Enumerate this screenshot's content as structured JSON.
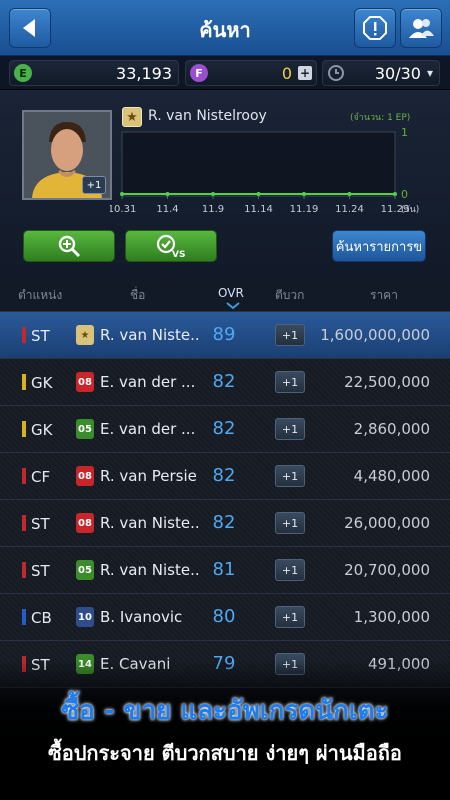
{
  "header": {
    "title": "ค้นหา"
  },
  "currency": {
    "e_label": "E",
    "e_value": "33,193",
    "f_label": "F",
    "f_value": "0",
    "plus": "+",
    "energy_value": "30/30",
    "dropdown": "▾"
  },
  "player": {
    "name": "R. van Nistelrooy",
    "photo_badge": "+1",
    "ep_note": "(จำนวน: 1 EP)",
    "chart_data": {
      "type": "line",
      "x": [
        "10.31",
        "11.4",
        "11.9",
        "11.14",
        "11.19",
        "11.24",
        "11.29"
      ],
      "x_unit": "(วัน)",
      "ylim": [
        0,
        1
      ],
      "y_ticks": [
        "1",
        "0"
      ],
      "values": [
        0,
        0,
        0,
        0,
        0,
        0,
        0
      ]
    }
  },
  "buttons": {
    "search_list": "ค้นหารายการข"
  },
  "table": {
    "headers": [
      "ตำแหน่ง",
      "ชื่อ",
      "OVR",
      "ตีบวก",
      "ราคา"
    ],
    "rows": [
      {
        "pos": "ST",
        "pos_color": "#c0282d",
        "season": "★",
        "season_bg": "#d9c27a",
        "season_fg": "#6b4d12",
        "name": "R. van Niste...",
        "ovr": "89",
        "plus": "+1",
        "price": "1,600,000,000",
        "selected": true
      },
      {
        "pos": "GK",
        "pos_color": "#d8b21e",
        "season": "08",
        "season_bg": "#c8262b",
        "season_fg": "#ffffff",
        "name": "E. van der ...",
        "ovr": "82",
        "plus": "+1",
        "price": "22,500,000"
      },
      {
        "pos": "GK",
        "pos_color": "#d8b21e",
        "season": "05",
        "season_bg": "#3b8c2a",
        "season_fg": "#ffffff",
        "name": "E. van der ...",
        "ovr": "82",
        "plus": "+1",
        "price": "2,860,000"
      },
      {
        "pos": "CF",
        "pos_color": "#c0282d",
        "season": "08",
        "season_bg": "#c8262b",
        "season_fg": "#ffffff",
        "name": "R. van Persie",
        "ovr": "82",
        "plus": "+1",
        "price": "4,480,000"
      },
      {
        "pos": "ST",
        "pos_color": "#c0282d",
        "season": "08",
        "season_bg": "#c8262b",
        "season_fg": "#ffffff",
        "name": "R. van Niste...",
        "ovr": "82",
        "plus": "+1",
        "price": "26,000,000"
      },
      {
        "pos": "ST",
        "pos_color": "#c0282d",
        "season": "05",
        "season_bg": "#3b8c2a",
        "season_fg": "#ffffff",
        "name": "R. van Niste...",
        "ovr": "81",
        "plus": "+1",
        "price": "20,700,000"
      },
      {
        "pos": "CB",
        "pos_color": "#1f5fc8",
        "season": "10",
        "season_bg": "#2e4d8a",
        "season_fg": "#ffffff",
        "name": "B. Ivanovic",
        "ovr": "80",
        "plus": "+1",
        "price": "1,300,000"
      },
      {
        "pos": "ST",
        "pos_color": "#c0282d",
        "season": "14",
        "season_bg": "#3b8c2a",
        "season_fg": "#ffffff",
        "name": "E. Cavani",
        "ovr": "79",
        "plus": "+1",
        "price": "491,000"
      }
    ]
  },
  "banner": {
    "headline": "ซื้อ - ขาย และอัพเกรดนักเตะ",
    "subline": "ซื้อปกระจาย ตีบวกสบาย ง่ายๆ ผ่านมือถือ"
  }
}
